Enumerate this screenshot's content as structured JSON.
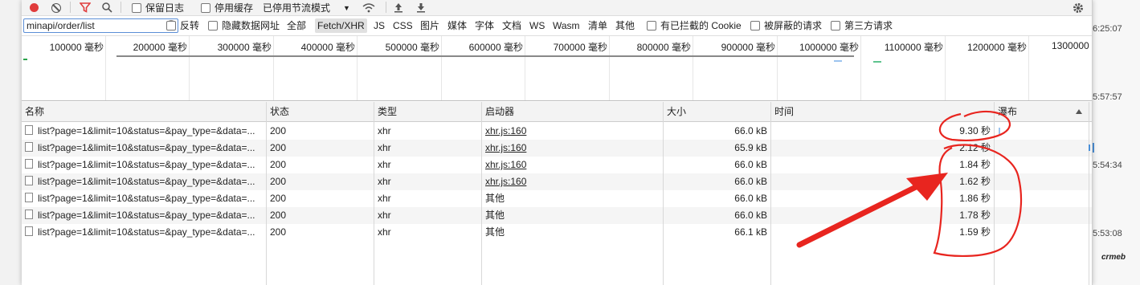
{
  "toolbar": {
    "preserve_log": "保留日志",
    "disable_cache": "停用缓存",
    "throttle": "已停用节流模式"
  },
  "filter": {
    "value": "minapi/order/list",
    "invert": "反转",
    "hide_data_urls": "隐藏数据网址",
    "types": [
      "全部",
      "Fetch/XHR",
      "JS",
      "CSS",
      "图片",
      "媒体",
      "字体",
      "文档",
      "WS",
      "Wasm",
      "清单",
      "其他"
    ],
    "active_type": "Fetch/XHR",
    "blocked_cookies": "有已拦截的 Cookie",
    "blocked_requests": "被屏蔽的请求",
    "third_party": "第三方请求"
  },
  "overview": {
    "ticks": [
      "100000 毫秒",
      "200000 毫秒",
      "300000 毫秒",
      "400000 毫秒",
      "500000 毫秒",
      "600000 毫秒",
      "700000 毫秒",
      "800000 毫秒",
      "900000 毫秒",
      "1000000 毫秒",
      "1100000 毫秒",
      "1200000 毫秒",
      "1300000"
    ]
  },
  "table": {
    "columns": [
      "名称",
      "状态",
      "类型",
      "启动器",
      "大小",
      "时间",
      "瀑布"
    ],
    "rows": [
      {
        "name": "list?page=1&limit=10&status=&pay_type=&data=...",
        "status": "200",
        "type": "xhr",
        "initiator": "xhr.js:160",
        "size": "66.0 kB",
        "time": "9.30 秒"
      },
      {
        "name": "list?page=1&limit=10&status=&pay_type=&data=...",
        "status": "200",
        "type": "xhr",
        "initiator": "xhr.js:160",
        "size": "65.9 kB",
        "time": "2.12 秒"
      },
      {
        "name": "list?page=1&limit=10&status=&pay_type=&data=...",
        "status": "200",
        "type": "xhr",
        "initiator": "xhr.js:160",
        "size": "66.0 kB",
        "time": "1.84 秒"
      },
      {
        "name": "list?page=1&limit=10&status=&pay_type=&data=...",
        "status": "200",
        "type": "xhr",
        "initiator": "xhr.js:160",
        "size": "66.0 kB",
        "time": "1.62 秒"
      },
      {
        "name": "list?page=1&limit=10&status=&pay_type=&data=...",
        "status": "200",
        "type": "xhr",
        "initiator": "其他",
        "size": "66.0 kB",
        "time": "1.86 秒"
      },
      {
        "name": "list?page=1&limit=10&status=&pay_type=&data=...",
        "status": "200",
        "type": "xhr",
        "initiator": "其他",
        "size": "66.0 kB",
        "time": "1.78 秒"
      },
      {
        "name": "list?page=1&limit=10&status=&pay_type=&data=...",
        "status": "200",
        "type": "xhr",
        "initiator": "其他",
        "size": "66.1 kB",
        "time": "1.59 秒"
      }
    ]
  },
  "background": {
    "timestamps": [
      "6:25:07",
      "5:57:57",
      "5:54:34",
      "5:53:08"
    ],
    "logo": "crmeb"
  },
  "colors": {
    "record": "#e03c3c",
    "annotation": "#e8251f",
    "accent": "#4a90d9"
  }
}
